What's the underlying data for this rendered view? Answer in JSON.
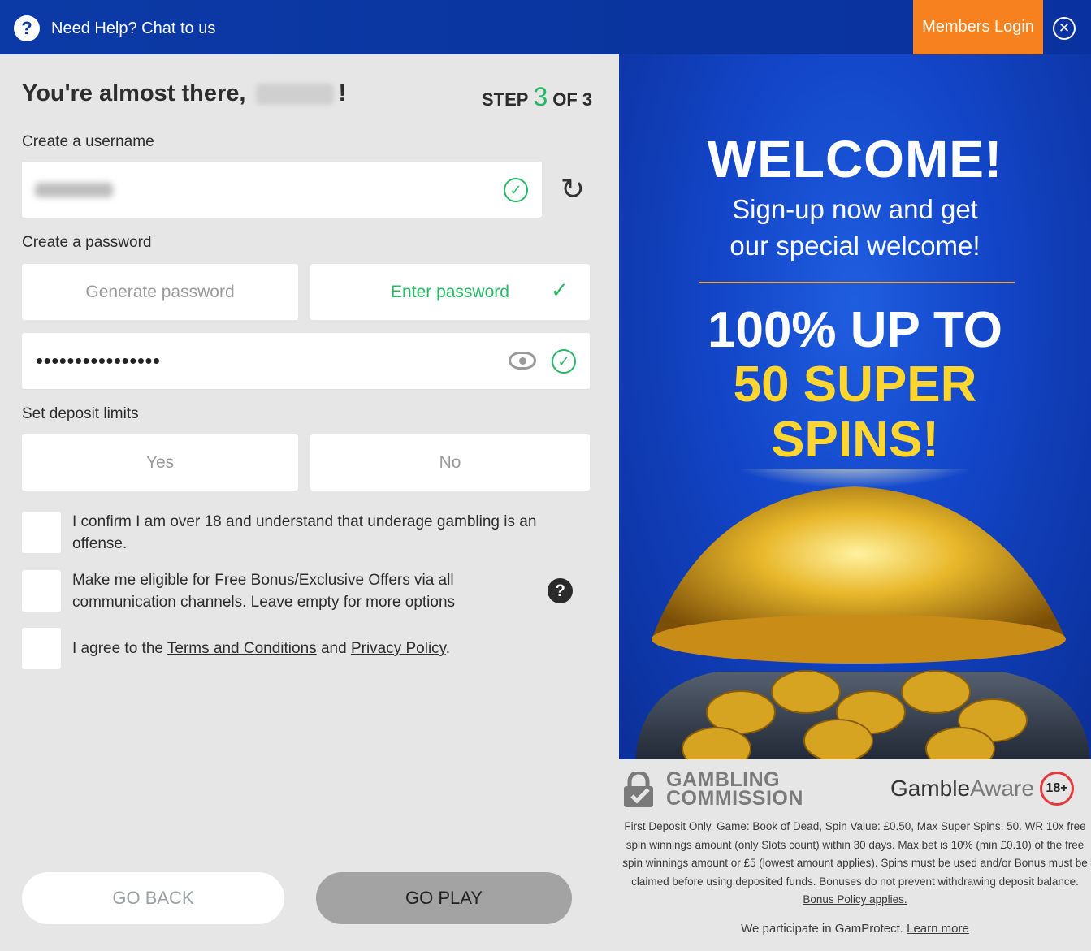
{
  "topbar": {
    "help_icon": "question-icon",
    "help_text": "Need Help? Chat to us",
    "members_login": "Members Login",
    "close_icon": "close-icon"
  },
  "form": {
    "title_prefix": "You're almost there,",
    "title_suffix": "!",
    "step_word": "STEP",
    "step_current": "3",
    "step_total": "OF 3",
    "username_label": "Create a username",
    "password_label": "Create a password",
    "generate_password": "Generate password",
    "enter_password": "Enter password",
    "password_value": "••••••••••••••••",
    "deposit_label": "Set deposit limits",
    "deposit_yes": "Yes",
    "deposit_no": "No",
    "confirm_age": "I confirm I am over 18 and understand that underage gambling is an offense.",
    "offers": "Make me eligible for Free Bonus/Exclusive Offers via all communication channels. Leave empty for more options",
    "agree_prefix": "I agree to the",
    "terms_link": "Terms and Conditions",
    "agree_and": "and",
    "privacy_link": "Privacy Policy",
    "agree_suffix": ".",
    "go_back": "GO BACK",
    "go_play": "GO PLAY",
    "accent_color": "#25b865"
  },
  "promo": {
    "welcome": "WELCOME!",
    "sub_line1": "Sign-up now and get",
    "sub_line2": "our special welcome!",
    "offer_line1": "100% UP TO",
    "offer_line2": "50 SUPER",
    "offer_line3": "SPINS!",
    "offer_color": "#ffd630"
  },
  "footer": {
    "gc_line1": "GAMBLING",
    "gc_line2": "COMMISSION",
    "ga_gamble": "Gamble",
    "ga_aware": "Aware",
    "age_badge": "18+",
    "terms_text": "First Deposit Only. Game: Book of Dead, Spin Value: £0.50, Max Super Spins: 50. WR 10x free spin winnings amount (only Slots count) within 30 days. Max bet is 10% (min £0.10) of the free spin winnings amount or £5 (lowest amount applies). Spins must be used and/or Bonus must be claimed before using deposited funds. Bonuses do not prevent withdrawing deposit balance.",
    "bonus_policy_link": "Bonus Policy applies.",
    "gamprotect_text": "We participate in GamProtect.",
    "learn_more": "Learn more"
  }
}
